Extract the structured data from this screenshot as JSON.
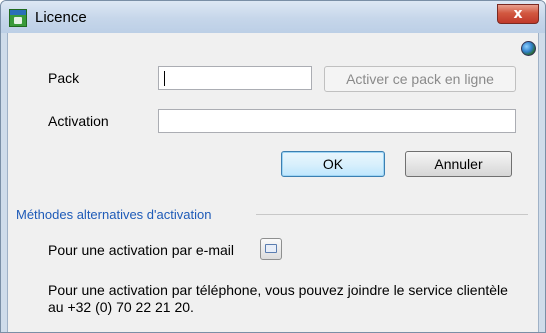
{
  "window": {
    "title": "Licence",
    "close_label": "x"
  },
  "form": {
    "pack_label": "Pack",
    "pack_value": "",
    "activate_online_label": "Activer ce pack en ligne",
    "activation_label": "Activation",
    "activation_value": ""
  },
  "buttons": {
    "ok_label": "OK",
    "cancel_label": "Annuler"
  },
  "alternatives": {
    "title": "Méthodes alternatives d'activation",
    "email_text": "Pour une activation par e-mail",
    "phone_text": "Pour une activation par téléphone, vous pouvez joindre le service clientèle au +32 (0) 70 22 21 20."
  },
  "icons": {
    "app": "app-icon",
    "globe": "globe-icon",
    "email": "email-icon",
    "close": "close-icon"
  },
  "colors": {
    "group_title": "#1e5bb8",
    "close_button": "#c0392b",
    "default_button_border": "#3c7fb1"
  }
}
